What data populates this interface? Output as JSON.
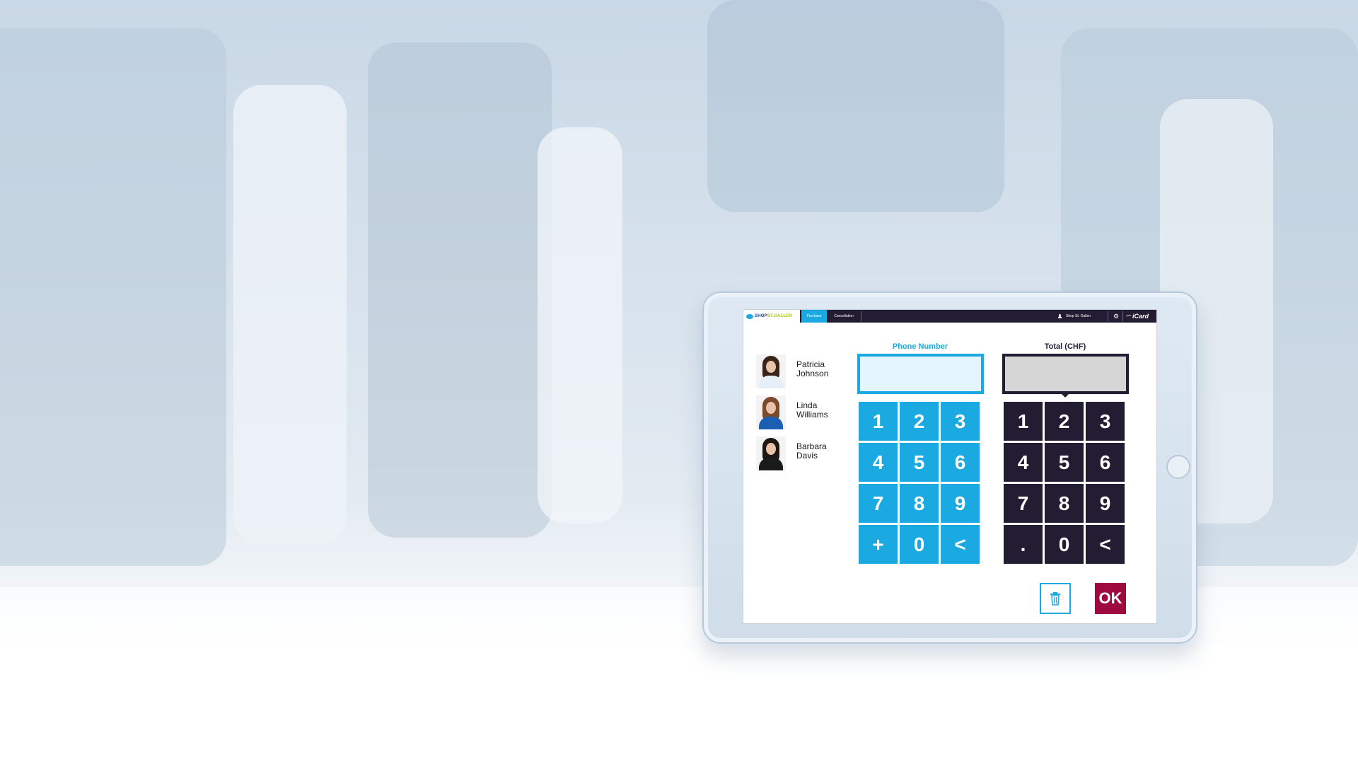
{
  "app": {
    "logo": {
      "part1": "SHOP",
      "part2": "ST.GALLEN"
    },
    "tabs": [
      {
        "label": "Purchase",
        "active": true
      },
      {
        "label": "Cancellation",
        "active": false
      }
    ],
    "user": {
      "label": "Shop St. Gallen",
      "icon": "user-icon"
    },
    "settings_icon": "gear-icon",
    "brand": "iCard"
  },
  "contacts": [
    {
      "name_line1": "Patricia",
      "name_line2": "Johnson"
    },
    {
      "name_line1": "Linda",
      "name_line2": "Williams"
    },
    {
      "name_line1": "Barbara",
      "name_line2": "Davis"
    }
  ],
  "phone": {
    "label": "Phone Number",
    "value": ""
  },
  "total": {
    "label": "Total (CHF)",
    "value": ""
  },
  "phone_keypad": [
    "1",
    "2",
    "3",
    "4",
    "5",
    "6",
    "7",
    "8",
    "9",
    "+",
    "0",
    "<"
  ],
  "total_keypad": [
    "1",
    "2",
    "3",
    "4",
    "5",
    "6",
    "7",
    "8",
    "9",
    ".",
    "0",
    "<"
  ],
  "actions": {
    "delete_icon": "trash-icon",
    "ok_label": "OK"
  },
  "colors": {
    "accent_blue": "#1aa9e0",
    "dark_navy": "#231d33",
    "ok_red": "#9e0a3d",
    "logo_green": "#a4c51b"
  }
}
